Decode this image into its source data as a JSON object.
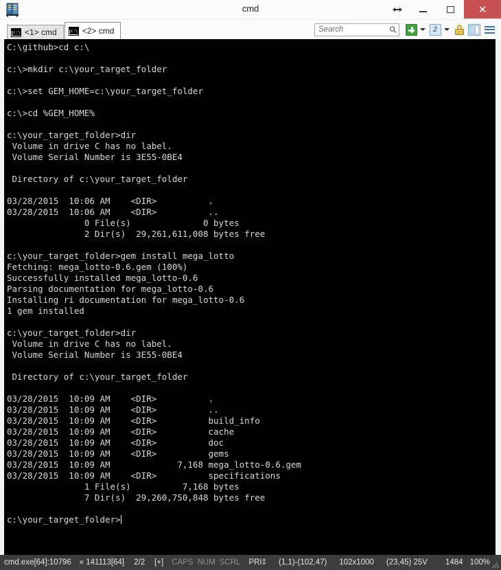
{
  "window": {
    "title": "cmd",
    "app_icon": "server-rack-icon",
    "controls": {
      "resize_label": "↔",
      "minimize_label": "–",
      "maximize_label": "□",
      "close_label": "✕"
    }
  },
  "tabs": [
    {
      "label": "<1> cmd",
      "icon": "console-icon",
      "active": false
    },
    {
      "label": "<2> cmd",
      "icon": "console-icon",
      "active": true
    }
  ],
  "toolbar": {
    "search_placeholder": "Search",
    "search_value": "",
    "new_console_label": "+",
    "active_console_count": "2",
    "lock_icon": "padlock-icon",
    "panels_icon": "split-panel-icon",
    "menu_icon": "hamburger-menu-icon"
  },
  "terminal": {
    "lines": [
      "C:\\github>cd c:\\",
      "",
      "c:\\>mkdir c:\\your_target_folder",
      "",
      "c:\\>set GEM_HOME=c:\\your_target_folder",
      "",
      "c:\\>cd %GEM_HOME%",
      "",
      "c:\\your_target_folder>dir",
      " Volume in drive C has no label.",
      " Volume Serial Number is 3E55-0BE4",
      "",
      " Directory of c:\\your_target_folder",
      "",
      "03/28/2015  10:06 AM    <DIR>          .",
      "03/28/2015  10:06 AM    <DIR>          ..",
      "               0 File(s)              0 bytes",
      "               2 Dir(s)  29,261,611,008 bytes free",
      "",
      "c:\\your_target_folder>gem install mega_lotto",
      "Fetching: mega_lotto-0.6.gem (100%)",
      "Successfully installed mega_lotto-0.6",
      "Parsing documentation for mega_lotto-0.6",
      "Installing ri documentation for mega_lotto-0.6",
      "1 gem installed",
      "",
      "c:\\your_target_folder>dir",
      " Volume in drive C has no label.",
      " Volume Serial Number is 3E55-0BE4",
      "",
      " Directory of c:\\your_target_folder",
      "",
      "03/28/2015  10:09 AM    <DIR>          .",
      "03/28/2015  10:09 AM    <DIR>          ..",
      "03/28/2015  10:09 AM    <DIR>          build_info",
      "03/28/2015  10:09 AM    <DIR>          cache",
      "03/28/2015  10:09 AM    <DIR>          doc",
      "03/28/2015  10:09 AM    <DIR>          gems",
      "03/28/2015  10:09 AM             7,168 mega_lotto-0.6.gem",
      "03/28/2015  10:09 AM    <DIR>          specifications",
      "               1 File(s)          7,168 bytes",
      "               7 Dir(s)  29,260,750,848 bytes free",
      "",
      "c:\\your_target_folder>"
    ],
    "prompt_has_cursor": true,
    "background": "#000000",
    "foreground": "#d8d8d8"
  },
  "statusbar": {
    "process": "cmd.exe[64]:10796",
    "build": "« 141113[64]",
    "tab_counter": "2/2",
    "plus_indicator": "[+]",
    "caps": "CAPS",
    "num": "NUM",
    "scrl": "SCRL",
    "print": "PRI‡",
    "selection": "(1,1)-(102,47)",
    "buffer_size": "102x1000",
    "cell": "(23,45) 25V",
    "memory": "1484",
    "zoom": "100%"
  },
  "colors": {
    "titlebar_bg": "#fbfbfb",
    "close_button": "#c75050",
    "terminal_bg": "#000000",
    "terminal_fg": "#d8d8d8",
    "statusbar_bg": "#3c3c3c",
    "accent_green": "#3fa63f",
    "accent_blue": "#7fa8d0"
  }
}
